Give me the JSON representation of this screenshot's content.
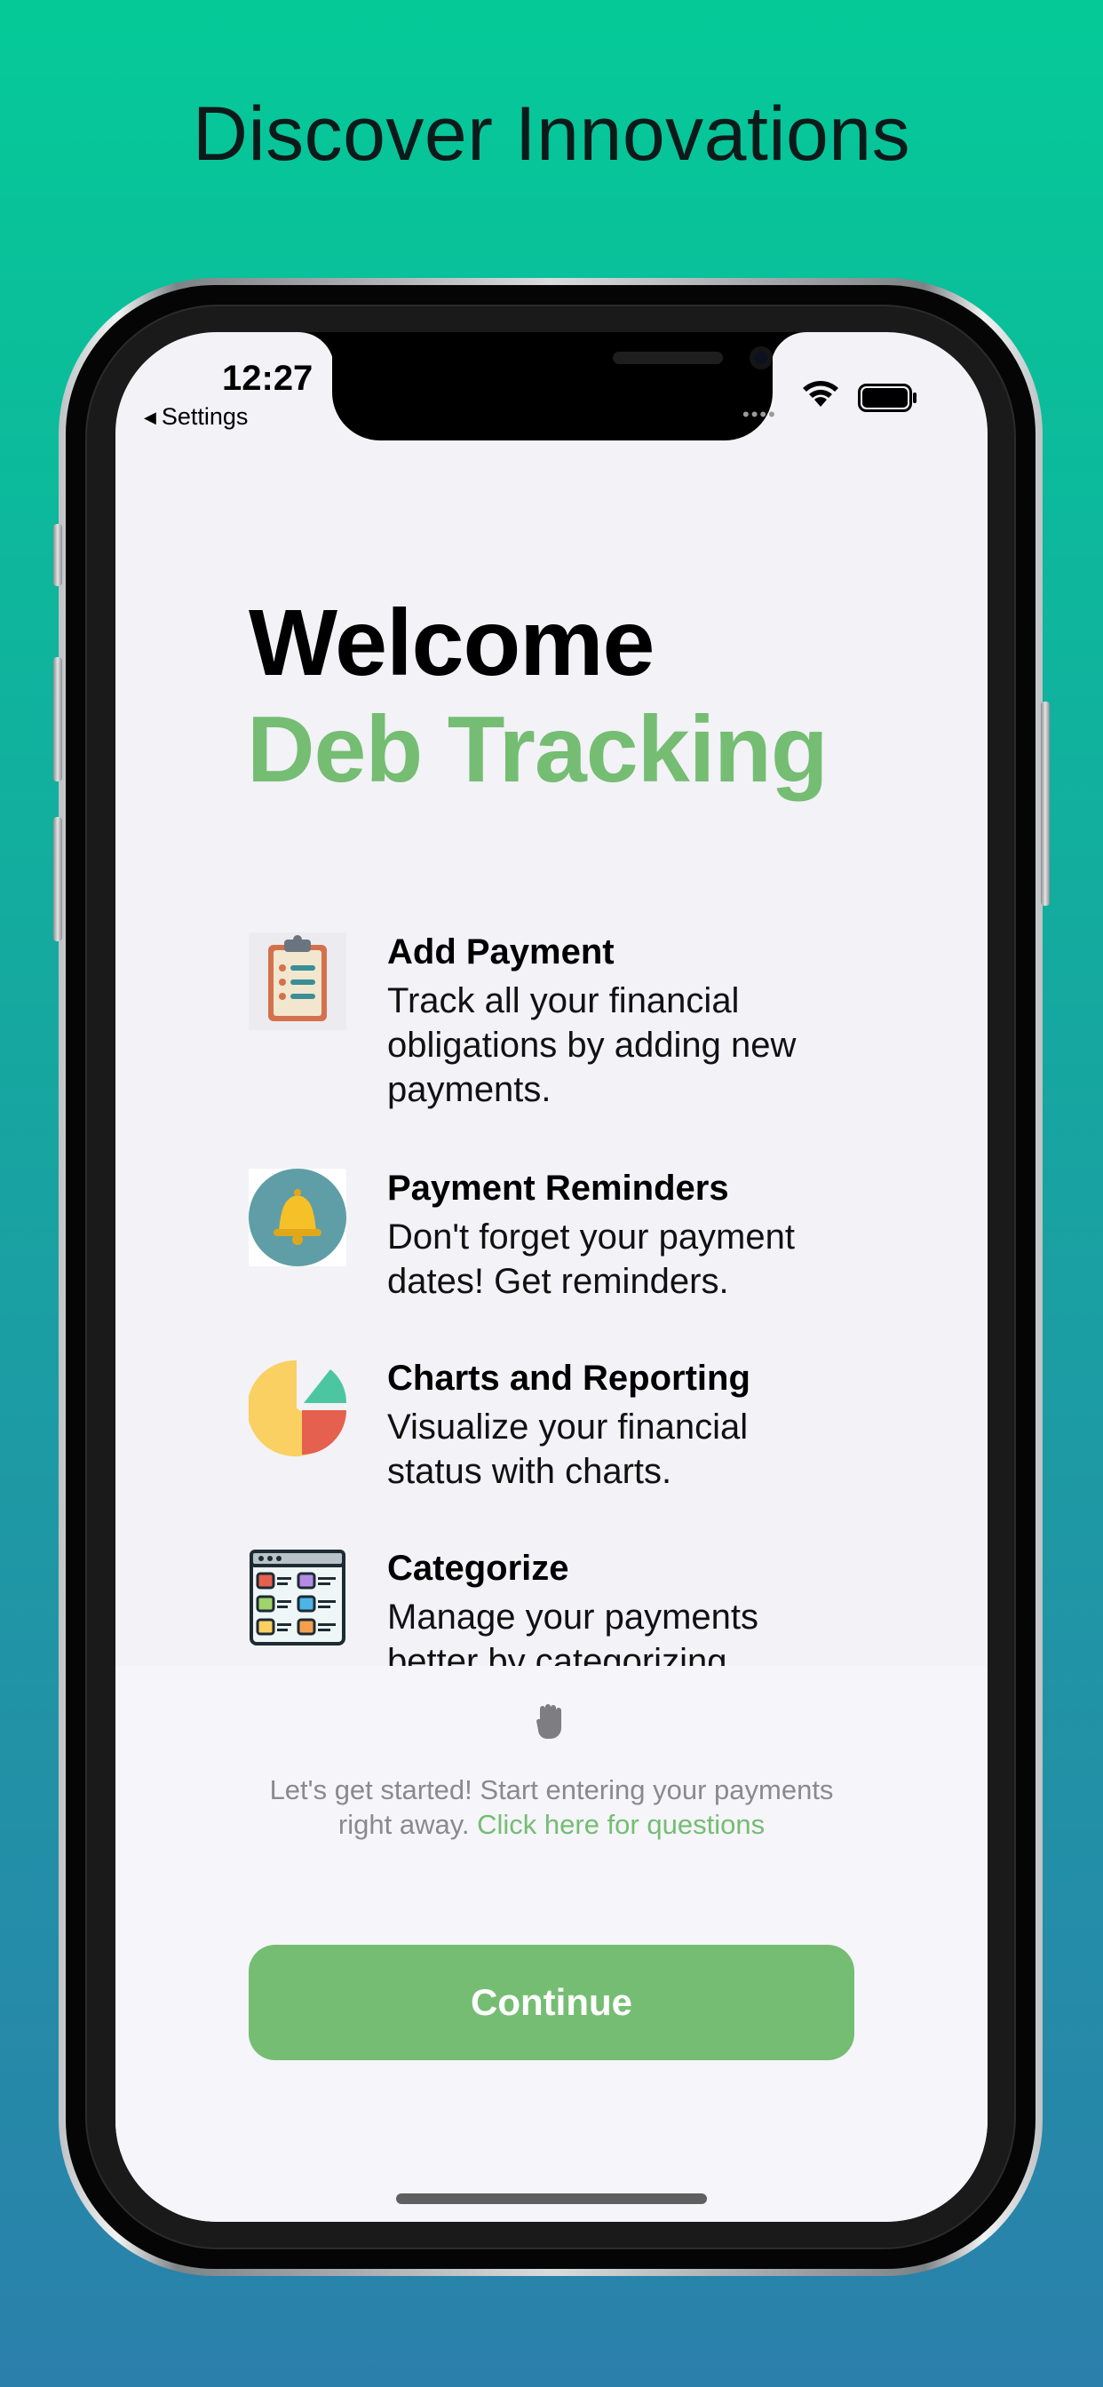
{
  "headline": "Discover Innovations",
  "status_bar": {
    "time": "12:27",
    "back_label": "Settings",
    "signal": "••••"
  },
  "welcome": {
    "line1": "Welcome",
    "line2": "Deb Tracking"
  },
  "features": [
    {
      "icon": "clipboard-icon",
      "title": "Add Payment",
      "description": "Track all your financial obligations by adding new payments."
    },
    {
      "icon": "bell-icon",
      "title": "Payment Reminders",
      "description": "Don't forget your payment dates! Get reminders."
    },
    {
      "icon": "pie-chart-icon",
      "title": "Charts and Reporting",
      "description": "Visualize your financial status with charts."
    },
    {
      "icon": "categories-icon",
      "title": "Categorize",
      "description": "Manage your payments better by categorizing"
    }
  ],
  "info": {
    "text": "Let's get started! Start entering your payments right away.",
    "link": "Click here for questions"
  },
  "continue_label": "Continue",
  "colors": {
    "accent": "#75bd72",
    "background_top": "#05ca98",
    "background_bottom": "#2a80ab"
  }
}
